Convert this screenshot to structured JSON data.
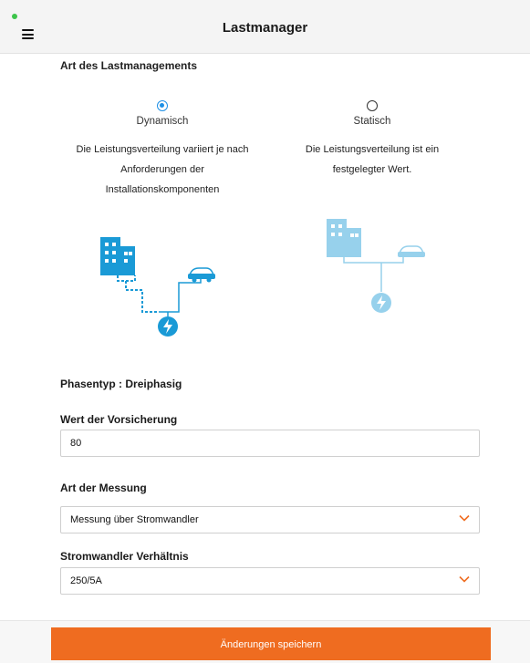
{
  "header": {
    "title": "Lastmanager"
  },
  "load_management": {
    "section_title": "Art des Lastmanagements",
    "options": [
      {
        "label": "Dynamisch",
        "selected": true,
        "description": [
          "Die Leistungsverteilung variiert je nach",
          "Anforderungen der",
          "Installationskomponenten"
        ]
      },
      {
        "label": "Statisch",
        "selected": false,
        "description": [
          "Die Leistungsverteilung ist ein",
          "festgelegter Wert."
        ]
      }
    ]
  },
  "phase": {
    "label": "Phasentyp :",
    "value": "Dreiphasig"
  },
  "fuse": {
    "label": "Wert der Vorsicherung",
    "value": "80"
  },
  "measurement": {
    "label": "Art der Messung",
    "value": "Messung über Stromwandler"
  },
  "ratio": {
    "label": "Stromwandler Verhältnis",
    "value": "250/5A"
  },
  "footer": {
    "save_label": "Änderungen speichern"
  },
  "colors": {
    "accent": "#1e90e6",
    "button": "#ef6c20",
    "illustration_dark": "#1a9ad6",
    "illustration_light": "#8fd0ee"
  },
  "icons": [
    "menu-icon",
    "building-icon",
    "car-icon",
    "lightning-icon",
    "chevron-down-icon"
  ]
}
